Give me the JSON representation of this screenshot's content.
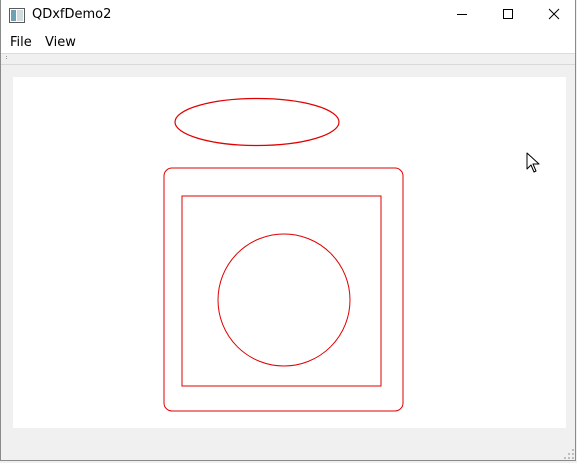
{
  "window": {
    "title": "QDxfDemo2",
    "controls": {
      "minimize_icon": "minimize-icon",
      "maximize_icon": "maximize-icon",
      "close_icon": "close-icon"
    }
  },
  "menubar": {
    "items": [
      {
        "label": "File"
      },
      {
        "label": "View"
      }
    ]
  },
  "drawing": {
    "stroke_color": "#e00000",
    "background": "#ffffff",
    "entities": [
      "ellipse",
      "rounded-rectangle",
      "rectangle",
      "circle"
    ]
  }
}
